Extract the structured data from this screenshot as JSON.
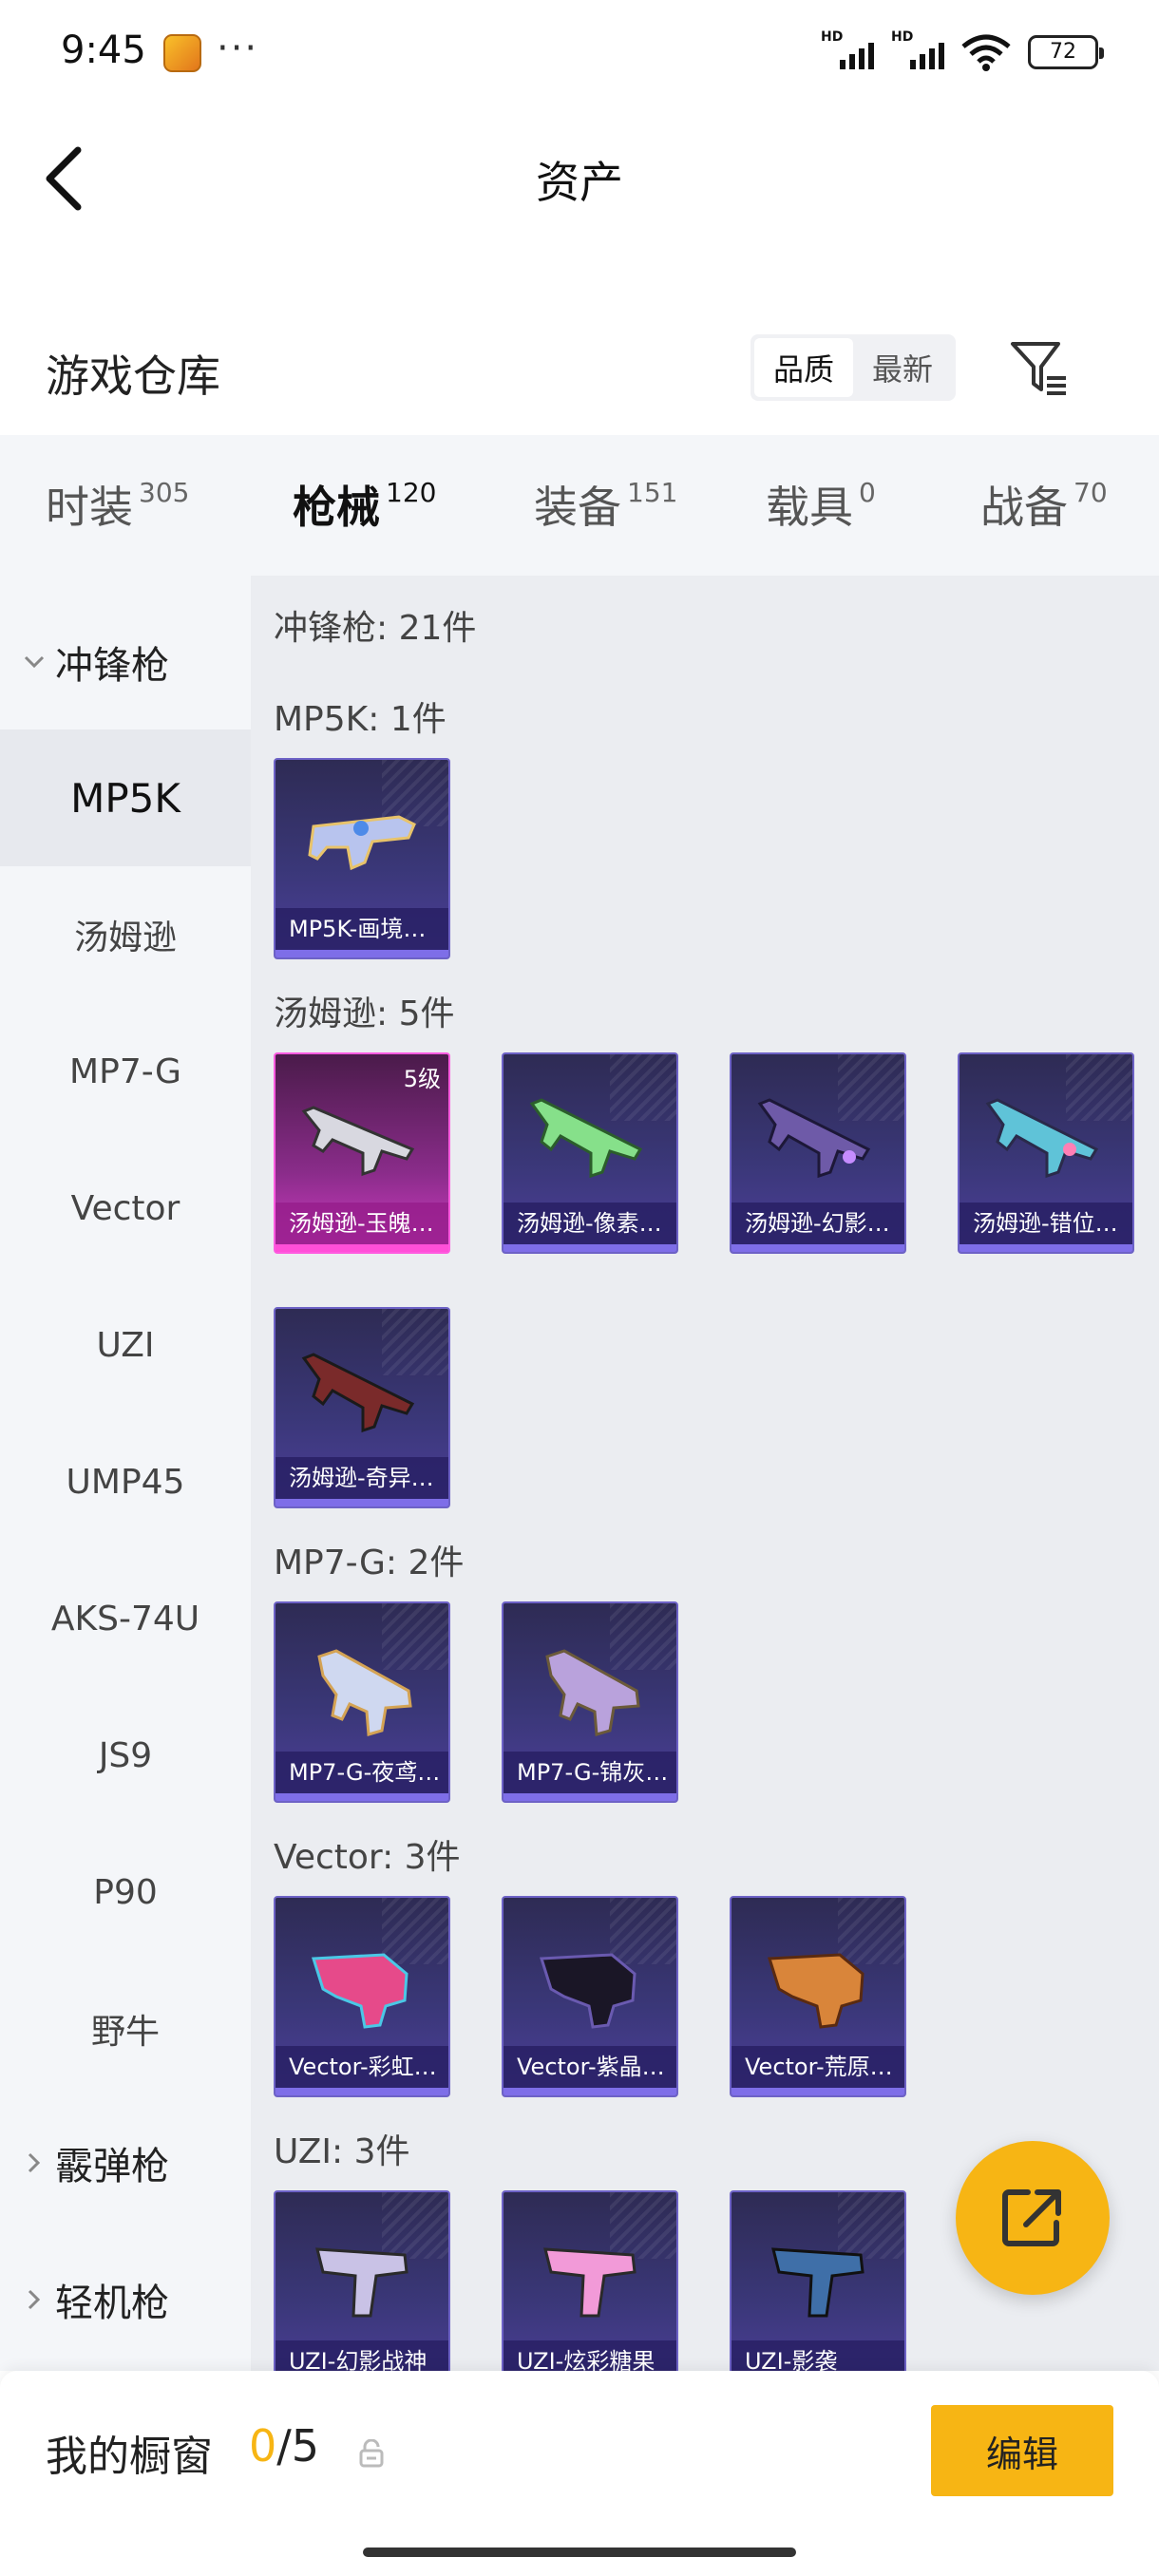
{
  "status_bar": {
    "time": "9:45",
    "dots": "···",
    "battery": "72",
    "signal_label": "HD"
  },
  "nav": {
    "title": "资产",
    "back_icon": "chevron-left-icon"
  },
  "warehouse": {
    "title": "游戏仓库",
    "sort_options": [
      "品质",
      "最新"
    ],
    "active_sort": "品质",
    "filter_icon": "filter-list-icon"
  },
  "tabs": [
    {
      "label": "时装",
      "count": "305"
    },
    {
      "label": "枪械",
      "count": "120",
      "active": true
    },
    {
      "label": "装备",
      "count": "151"
    },
    {
      "label": "载具",
      "count": "0"
    },
    {
      "label": "战备",
      "count": "70"
    }
  ],
  "sidebar": {
    "group_open": "冲锋枪",
    "items": [
      "MP5K",
      "汤姆逊",
      "MP7-G",
      "Vector",
      "UZI",
      "UMP45",
      "AKS-74U",
      "JS9",
      "P90",
      "野牛"
    ],
    "active_item": "MP5K",
    "groups_closed": [
      "霰弹枪",
      "轻机枪"
    ]
  },
  "content": {
    "category_header": "冲锋枪: 21件",
    "sections": [
      {
        "header": "MP5K: 1件",
        "cards": [
          {
            "caption": "MP5K-画境…"
          }
        ]
      },
      {
        "header": "汤姆逊: 5件",
        "cards": [
          {
            "caption": "汤姆逊-玉魄…",
            "level": "5级",
            "rarity": "pink"
          },
          {
            "caption": "汤姆逊-像素…"
          },
          {
            "caption": "汤姆逊-幻影…"
          },
          {
            "caption": "汤姆逊-错位…"
          },
          {
            "caption": "汤姆逊-奇异…"
          }
        ]
      },
      {
        "header": "MP7-G: 2件",
        "cards": [
          {
            "caption": "MP7-G-夜鸢…"
          },
          {
            "caption": "MP7-G-锦灰…"
          }
        ]
      },
      {
        "header": "Vector: 3件",
        "cards": [
          {
            "caption": "Vector-彩虹…"
          },
          {
            "caption": "Vector-紫晶…"
          },
          {
            "caption": "Vector-荒原…"
          }
        ]
      },
      {
        "header": "UZI: 3件",
        "cards": [
          {
            "caption": "UZI-幻影战神"
          },
          {
            "caption": "UZI-炫彩糖果"
          },
          {
            "caption": "UZI-影袭"
          }
        ]
      }
    ]
  },
  "fab": {
    "icon": "share-export-icon"
  },
  "showcase": {
    "title": "我的橱窗",
    "current": "0",
    "separator": "/",
    "total": "5",
    "lock_icon": "lock-icon",
    "edit_label": "编辑"
  },
  "colors": {
    "accent": "#f7b514",
    "card_purple": "#3a3778",
    "card_pink": "#d23cc4"
  }
}
